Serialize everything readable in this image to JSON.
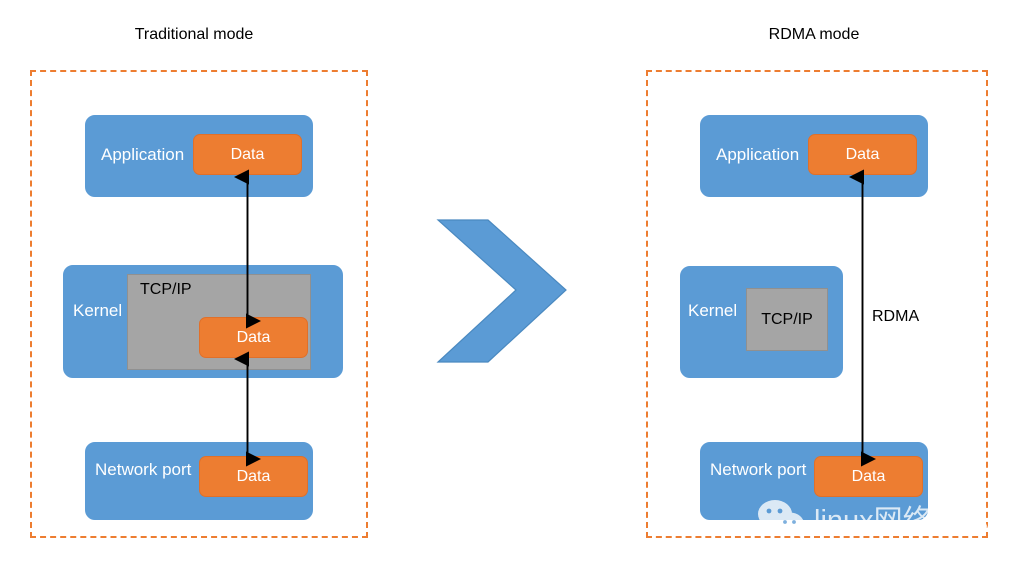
{
  "diagram": {
    "panels": [
      {
        "id": "traditional",
        "title": "Traditional mode",
        "layers": [
          {
            "name": "application",
            "label": "Application",
            "data_label": "Data"
          },
          {
            "name": "kernel",
            "label": "Kernel",
            "stack_label": "TCP/IP",
            "data_label": "Data"
          },
          {
            "name": "network-port",
            "label": "Network port",
            "data_label": "Data"
          }
        ]
      },
      {
        "id": "rdma",
        "title": "RDMA mode",
        "layers": [
          {
            "name": "application",
            "label": "Application",
            "data_label": "Data"
          },
          {
            "name": "kernel",
            "label": "Kernel",
            "stack_label": "TCP/IP"
          },
          {
            "name": "network-port",
            "label": "Network port",
            "data_label": "Data"
          }
        ],
        "path_label": "RDMA"
      }
    ],
    "transition_icon": "chevron-right-icon",
    "watermark": {
      "icon": "wechat-icon",
      "text": "linux网络虚拟化"
    },
    "colors": {
      "blue": "#5b9bd5",
      "orange": "#ed7d31",
      "gray": "#a5a5a5",
      "frame": "#ed7d31",
      "arrow": "#000000",
      "background": "#ffffff"
    }
  }
}
